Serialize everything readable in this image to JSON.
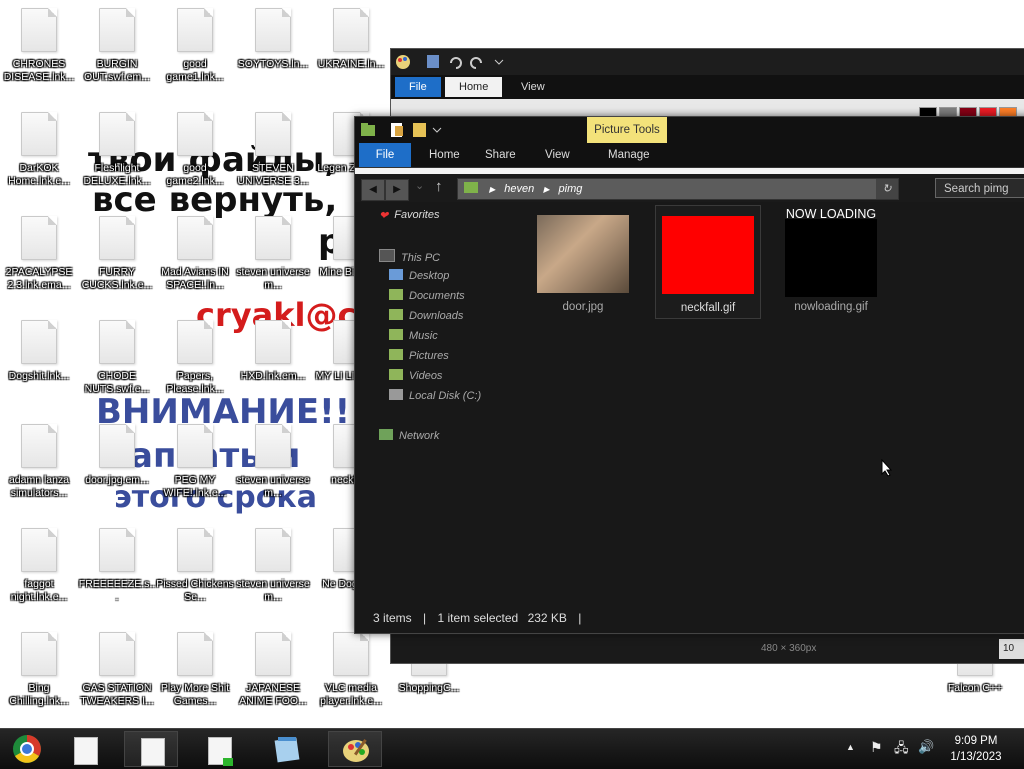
{
  "wallpaper": {
    "lines": [
      "твои файлы,",
      "все вернуть,",
      "рай",
      "cryakl@co",
      "ВНИМАНИЕ!!!",
      "апсать м",
      "этого срока"
    ]
  },
  "desktop_icons": [
    {
      "label": "CHRONES DISEASE.lnk..."
    },
    {
      "label": "BURGIN OUT.swf.em..."
    },
    {
      "label": "good game1.lnk..."
    },
    {
      "label": "SOYTOYS.ln..."
    },
    {
      "label": "UKRAINE.ln..."
    },
    {
      "label": "DarKOK Home.lnk.e..."
    },
    {
      "label": "Fleshlight DELUXE.lnk..."
    },
    {
      "label": "good game2.lnk..."
    },
    {
      "label": "STEVEN UNIVERSE 3..."
    },
    {
      "label": "Legen Zelda..."
    },
    {
      "label": "2PACALYPSE 2.3.lnk.ema..."
    },
    {
      "label": "FURRY CUCKS.lnk.e..."
    },
    {
      "label": "Mad Avians IN SPACE!.ln..."
    },
    {
      "label": "steven universe m..."
    },
    {
      "label": "Mine Birds.l..."
    },
    {
      "label": "Dogshit.lnk..."
    },
    {
      "label": "CHODE NUTS.swf.e..."
    },
    {
      "label": "Papers, Please.lnk..."
    },
    {
      "label": "HXD.lnk.em..."
    },
    {
      "label": "MY LI LIKE A..."
    },
    {
      "label": "adamn lanza simulators..."
    },
    {
      "label": "door.jpg.em..."
    },
    {
      "label": "PEG MY WIFE!.lnk.e..."
    },
    {
      "label": "steven universe m..."
    },
    {
      "label": "neckfa..."
    },
    {
      "label": "faggot night.lnk.e..."
    },
    {
      "label": "FREEEEEZE.s..."
    },
    {
      "label": "Pissed Chickens Se..."
    },
    {
      "label": "steven universe m..."
    },
    {
      "label": "Ne Dogshi..."
    },
    {
      "label": "Bing Chilling.lnk..."
    },
    {
      "label": "GAS STATION TWEAKERS I..."
    },
    {
      "label": "Play More Shit Games..."
    },
    {
      "label": "JAPANESE ANIME FOO..."
    },
    {
      "label": "VLC media player.lnk.e..."
    },
    {
      "label": "ShoppingC..."
    },
    {
      "label": "Falcon C++"
    }
  ],
  "paint": {
    "tabs": {
      "file": "File",
      "home": "Home",
      "view": "View"
    },
    "status_dim": "480 × 360px",
    "zoom": "10"
  },
  "explorer": {
    "context_tab": "Picture Tools",
    "tabs": {
      "file": "File",
      "home": "Home",
      "share": "Share",
      "view": "View",
      "manage": "Manage"
    },
    "path": [
      "heven",
      "pimg"
    ],
    "search_placeholder": "Search pimg",
    "nav": {
      "favorites": "Favorites",
      "this_pc": "This PC",
      "desktop": "Desktop",
      "documents": "Documents",
      "downloads": "Downloads",
      "music": "Music",
      "pictures": "Pictures",
      "videos": "Videos",
      "local_disk": "Local Disk (C:)",
      "network": "Network"
    },
    "files": [
      {
        "name": "door.jpg"
      },
      {
        "name": "neckfall.gif"
      },
      {
        "name": "nowloading.gif",
        "overlay": "NOW LOADING"
      }
    ],
    "status": {
      "items": "3 items",
      "selected": "1 item selected",
      "size": "232 KB"
    }
  },
  "clock": {
    "time": "9:09 PM",
    "date": "1/13/2023"
  },
  "colors": {
    "file_tab": "#1e6ec8",
    "context": "#f3e27a",
    "selected_thumb": "#ff0000"
  }
}
